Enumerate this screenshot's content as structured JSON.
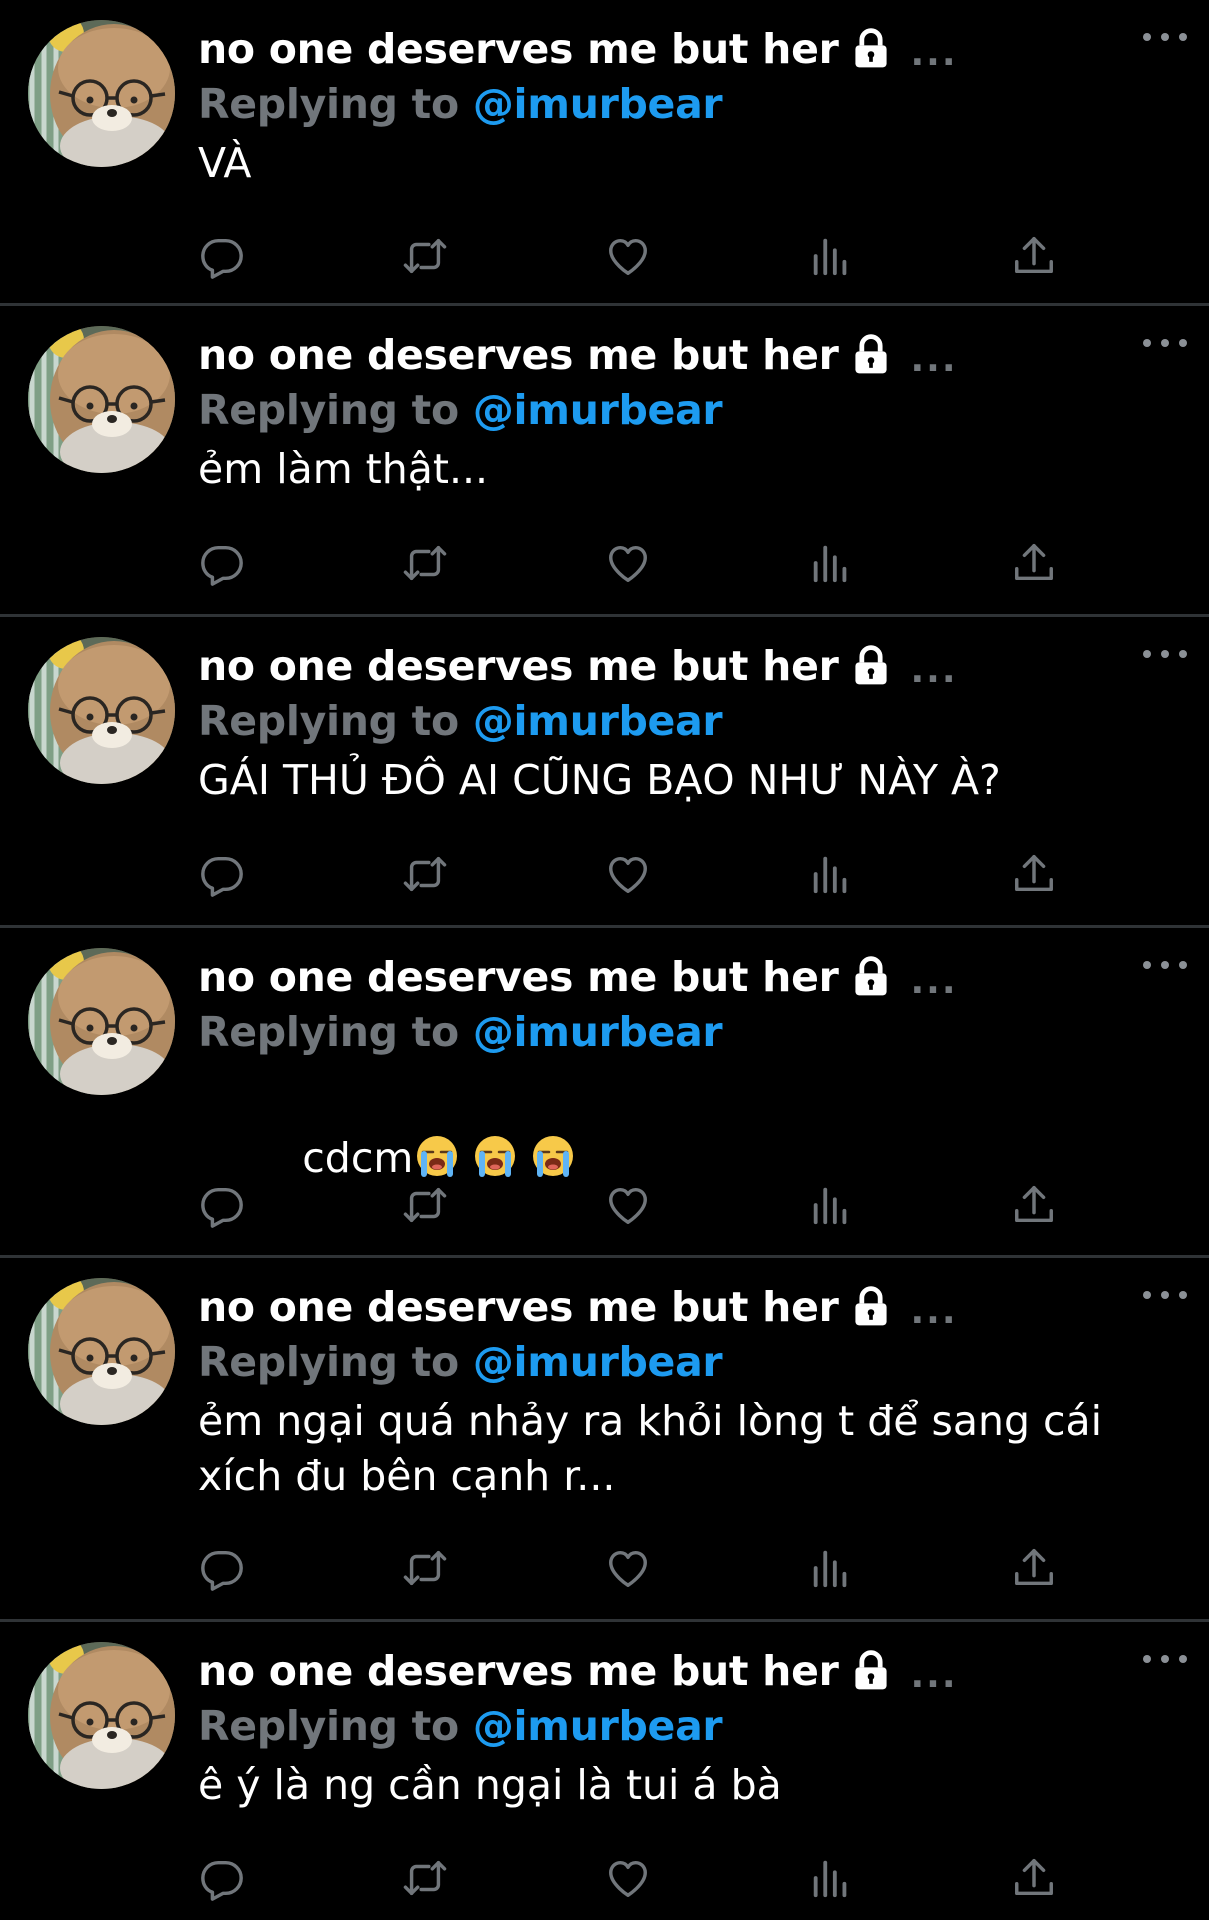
{
  "display_name": "no one deserves me but her",
  "handle_ellipsis": "...",
  "reply_prefix": "Replying to",
  "reply_handle": "@imurbear",
  "tweets": [
    {
      "text": "VÀ"
    },
    {
      "text": "ẻm làm thật..."
    },
    {
      "text": "GÁI THỦ ĐÔ AI CŨNG BẠO NHƯ NÀY À?"
    },
    {
      "text": "cdcm",
      "emoji": [
        "loudly-crying-face",
        "loudly-crying-face",
        "loudly-crying-face"
      ]
    },
    {
      "text": "ẻm ngại quá nhảy ra khỏi lòng t để sang cái\nxích đu bên cạnh r..."
    },
    {
      "text": "ê ý là ng cần ngại là tui á bà"
    }
  ],
  "icons": {
    "lock": "lock-icon",
    "reply": "reply-icon",
    "retweet": "retweet-icon",
    "like": "heart-icon",
    "views": "views-icon",
    "share": "share-icon",
    "more": "more-icon"
  },
  "colors": {
    "background": "#000000",
    "text": "#ffffff",
    "secondary": "#71767b",
    "accent": "#1d9bf0",
    "divider": "#2f3336"
  }
}
